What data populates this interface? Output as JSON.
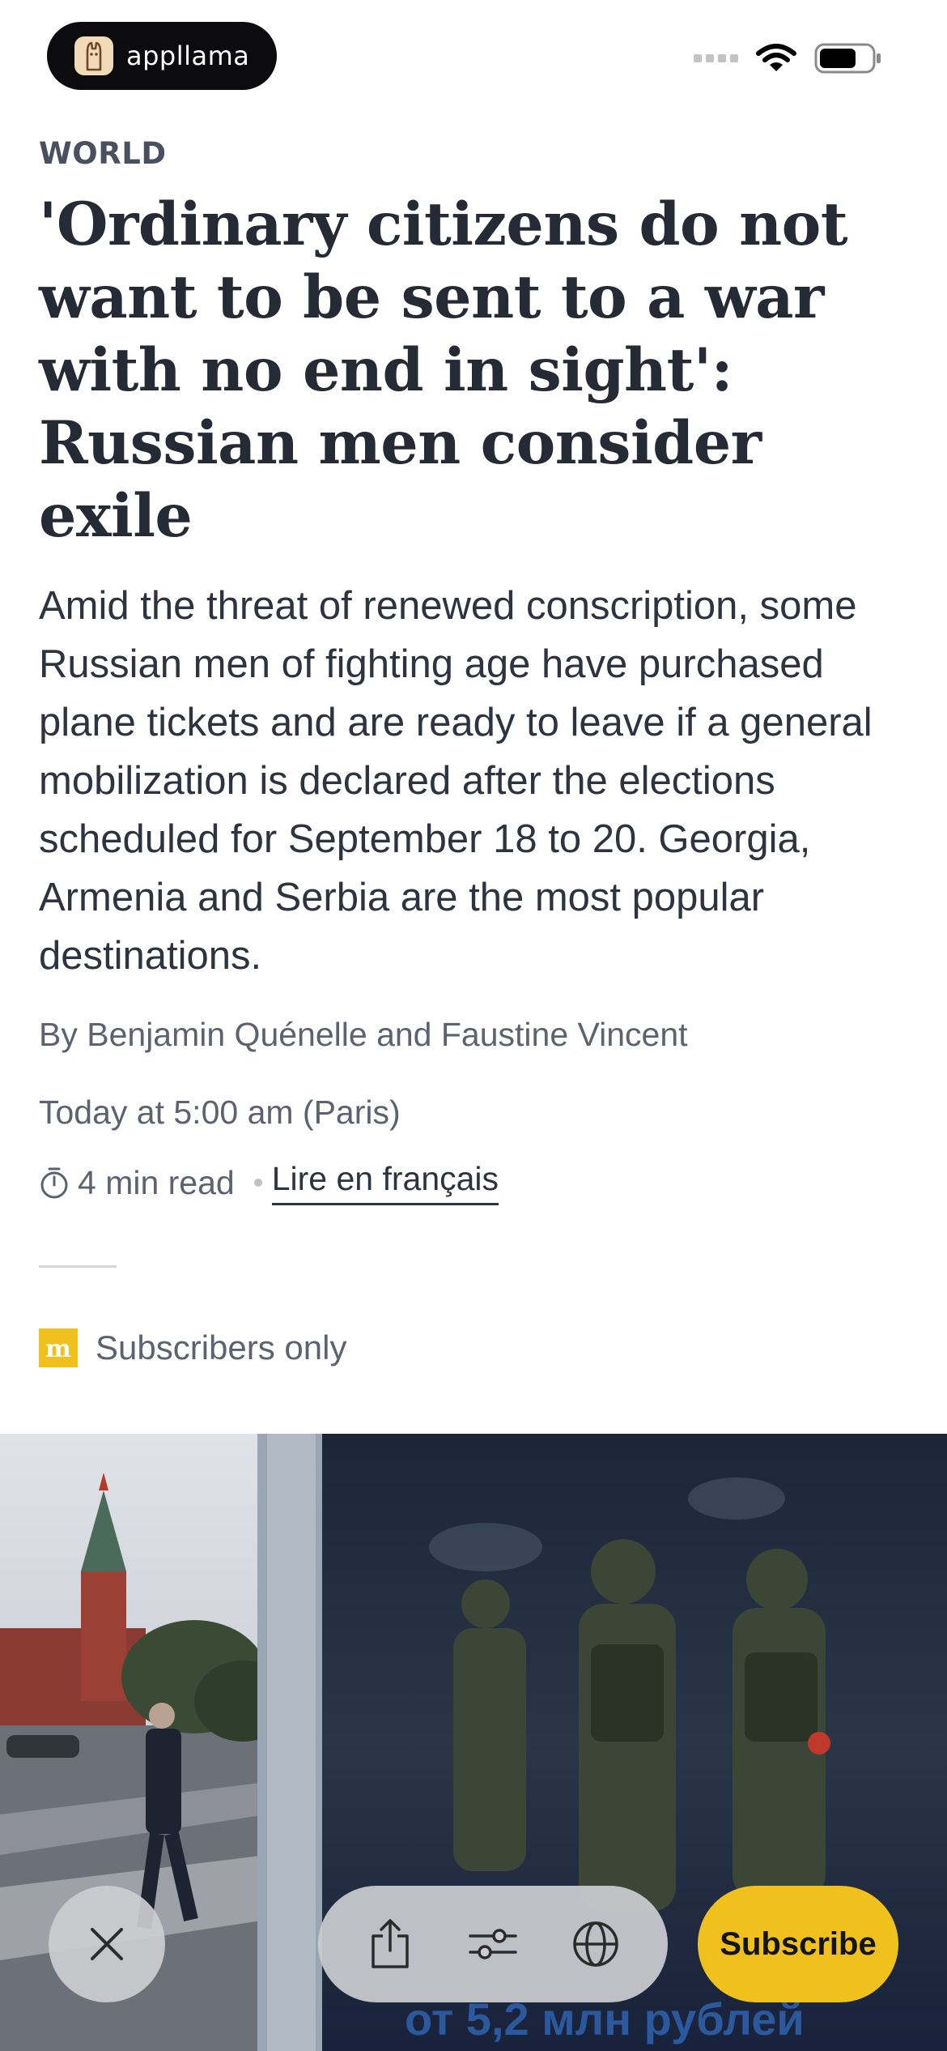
{
  "status_bar": {
    "brand": "appllama"
  },
  "article": {
    "section": "WORLD",
    "headline": "'Ordinary citizens do not want to be sent to a war with no end in sight': Russian men consider exile",
    "standfirst": "Amid the threat of renewed conscription, some Russian men of fighting age have purchased plane tickets and are ready to leave if a general mobilization is declared after the elections scheduled for September 18 to 20. Georgia, Armenia and Serbia are the most popular destinations.",
    "byline": "By Benjamin Quénelle and Faustine Vincent",
    "timestamp": "Today at 5:00 am (Paris)",
    "read_time": "4 min read",
    "language_link": "Lire en français",
    "access_label": "Subscribers only"
  },
  "hero_image": {
    "poster_text": "от 5,2 млн рублей"
  },
  "toolbar": {
    "subscribe_label": "Subscribe"
  },
  "colors": {
    "accent": "#f0c01c",
    "headline": "#262a35",
    "secondary_text": "#5e6270"
  },
  "icons": [
    "llama-icon",
    "signal-icon",
    "wifi-icon",
    "battery-icon",
    "timer-icon",
    "le-monde-m-icon",
    "close-icon",
    "share-icon",
    "sliders-icon",
    "globe-icon"
  ]
}
